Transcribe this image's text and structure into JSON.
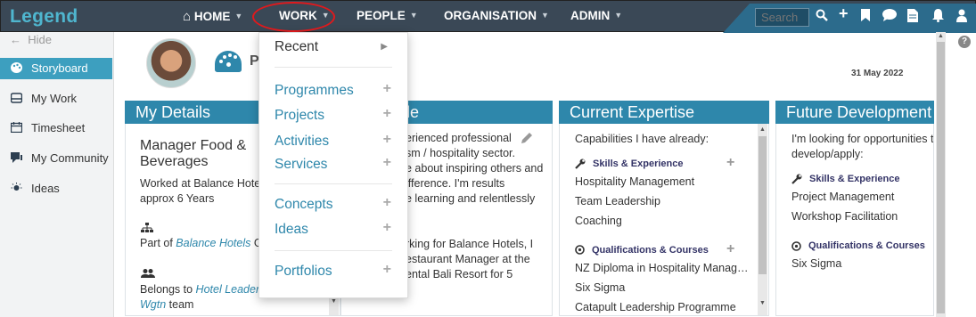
{
  "app": {
    "logo": "Legend"
  },
  "nav": {
    "items": [
      {
        "label": "HOME",
        "icon": "home-icon"
      },
      {
        "label": "WORK"
      },
      {
        "label": "PEOPLE"
      },
      {
        "label": "ORGANISATION"
      },
      {
        "label": "ADMIN"
      }
    ],
    "search_placeholder": "Search"
  },
  "sidebar": {
    "hide_label": "Hide",
    "items": [
      {
        "label": "Storyboard",
        "icon": "palette-icon",
        "active": true
      },
      {
        "label": "My Work",
        "icon": "inbox-icon"
      },
      {
        "label": "Timesheet",
        "icon": "calendar-icon"
      },
      {
        "label": "My Community",
        "icon": "chat-icon"
      },
      {
        "label": "Ideas",
        "icon": "lightbulb-icon"
      }
    ]
  },
  "header": {
    "title_partial": "P",
    "date": "31 May 2022"
  },
  "panels": {
    "details": {
      "title": "My Details",
      "role": [
        "Manager Food &",
        "Beverages"
      ],
      "worked": [
        "Worked at Balance Hotels",
        "approx 6 Years"
      ],
      "part_of_prefix": "Part of ",
      "part_of_link": "Balance Hotels",
      "part_of_suffix": " Gr",
      "belongs_prefix": "Belongs to ",
      "belongs_link": "Hotel Leaders",
      "belongs_link2": "Wgtn",
      "belongs_suffix": " team"
    },
    "profile": {
      "title_partial": "le",
      "bio": [
        "erienced professional",
        "sm / hospitality sector.",
        "e about inspiring others and",
        "ifference. I'm results",
        "e learning and relentlessly"
      ],
      "current": [
        "rking for Balance Hotels, I",
        "estaurant Manager at the",
        "ental Bali Resort for 5"
      ]
    },
    "expertise": {
      "title": "Current Expertise",
      "intro": "Capabilities I have already:",
      "skills_heading": "Skills & Experience",
      "skills": [
        "Hospitality Management",
        "Team Leadership",
        "Coaching"
      ],
      "quals_heading": "Qualifications & Courses",
      "quals": [
        "NZ Diploma in Hospitality Manag…",
        "Six Sigma",
        "Catapult Leadership Programme"
      ]
    },
    "future": {
      "title": "Future Development",
      "intro": [
        "I'm looking for opportunities to",
        "develop/apply:"
      ],
      "skills_heading": "Skills & Experience",
      "skills": [
        "Project Management",
        "Workshop Facilitation"
      ],
      "quals_heading": "Qualifications & Courses",
      "quals": [
        "Six Sigma"
      ]
    }
  },
  "work_menu": {
    "recent": "Recent",
    "items": [
      "Programmes",
      "Projects",
      "Activities",
      "Services",
      "Concepts",
      "Ideas",
      "Portfolios"
    ]
  },
  "colors": {
    "accent": "#2e87ab",
    "topbar": "#3a4856",
    "highlight": "#e0191c"
  }
}
